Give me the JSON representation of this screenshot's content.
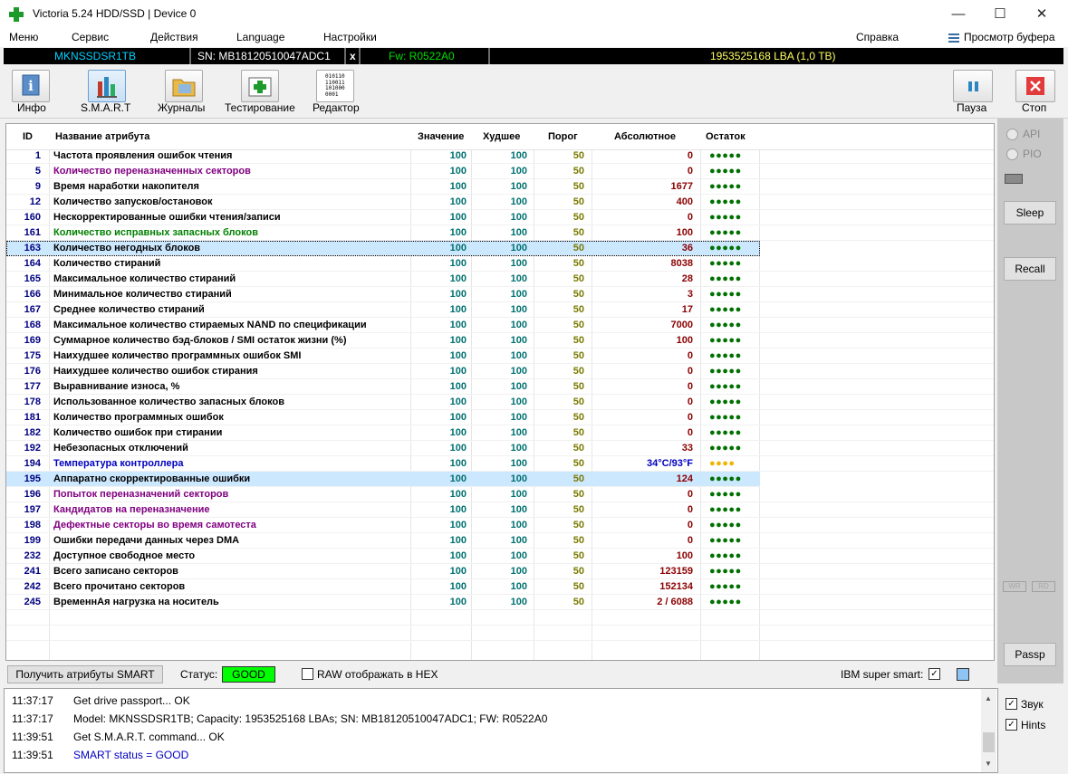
{
  "window": {
    "title": "Victoria 5.24 HDD/SSD | Device 0",
    "minimize": "—",
    "maximize": "☐",
    "close": "✕"
  },
  "menu": {
    "items": [
      "Меню",
      "Сервис",
      "Действия",
      "Language",
      "Настройки"
    ],
    "help": "Справка",
    "buffer": "Просмотр буфера"
  },
  "device": {
    "model": "MKNSSDSR1TB",
    "serial": "SN: MB18120510047ADC1",
    "close": "x",
    "firmware": "Fw: R0522A0",
    "capacity": "1953525168 LBA (1,0 TB)"
  },
  "toolbar": {
    "info": "Инфо",
    "smart": "S.M.A.R.T",
    "logs": "Журналы",
    "testing": "Тестирование",
    "editor": "Редактор",
    "editor_icon_text": "010110\n110011\n101000\n0001",
    "pause": "Пауза",
    "stop": "Стоп"
  },
  "table": {
    "headers": [
      "ID",
      "Название атрибута",
      "Значение",
      "Худшее",
      "Порог",
      "Абсолютное",
      "Остаток"
    ],
    "rows": [
      {
        "id": "1",
        "name": "Частота проявления ошибок чтения",
        "value": "100",
        "worst": "100",
        "threshold": "50",
        "raw": "0",
        "rem": "●●●●●",
        "color": "#000000"
      },
      {
        "id": "5",
        "name": "Количество переназначенных секторов",
        "value": "100",
        "worst": "100",
        "threshold": "50",
        "raw": "0",
        "rem": "●●●●●",
        "color": "#800080"
      },
      {
        "id": "9",
        "name": "Время наработки накопителя",
        "value": "100",
        "worst": "100",
        "threshold": "50",
        "raw": "1677",
        "rem": "●●●●●",
        "color": "#000000"
      },
      {
        "id": "12",
        "name": "Количество запусков/остановок",
        "value": "100",
        "worst": "100",
        "threshold": "50",
        "raw": "400",
        "rem": "●●●●●",
        "color": "#000000"
      },
      {
        "id": "160",
        "name": "Нескорректированные ошибки чтения/записи",
        "value": "100",
        "worst": "100",
        "threshold": "50",
        "raw": "0",
        "rem": "●●●●●",
        "color": "#000000"
      },
      {
        "id": "161",
        "name": "Количество исправных запасных блоков",
        "value": "100",
        "worst": "100",
        "threshold": "50",
        "raw": "100",
        "rem": "●●●●●",
        "color": "#008000"
      },
      {
        "id": "163",
        "name": "Количество негодных блоков",
        "value": "100",
        "worst": "100",
        "threshold": "50",
        "raw": "36",
        "rem": "●●●●●",
        "color": "#000000",
        "selected": true
      },
      {
        "id": "164",
        "name": "Количество стираний",
        "value": "100",
        "worst": "100",
        "threshold": "50",
        "raw": "8038",
        "rem": "●●●●●",
        "color": "#000000"
      },
      {
        "id": "165",
        "name": "Максимальное количество стираний",
        "value": "100",
        "worst": "100",
        "threshold": "50",
        "raw": "28",
        "rem": "●●●●●",
        "color": "#000000"
      },
      {
        "id": "166",
        "name": "Минимальное количество стираний",
        "value": "100",
        "worst": "100",
        "threshold": "50",
        "raw": "3",
        "rem": "●●●●●",
        "color": "#000000"
      },
      {
        "id": "167",
        "name": "Среднее количество стираний",
        "value": "100",
        "worst": "100",
        "threshold": "50",
        "raw": "17",
        "rem": "●●●●●",
        "color": "#000000"
      },
      {
        "id": "168",
        "name": "Максимальное количество стираемых NAND по спецификации",
        "value": "100",
        "worst": "100",
        "threshold": "50",
        "raw": "7000",
        "rem": "●●●●●",
        "color": "#000000"
      },
      {
        "id": "169",
        "name": "Суммарное количество бэд-блоков / SMI остаток жизни (%)",
        "value": "100",
        "worst": "100",
        "threshold": "50",
        "raw": "100",
        "rem": "●●●●●",
        "color": "#000000"
      },
      {
        "id": "175",
        "name": "Наихудшее количество программных ошибок SMI",
        "value": "100",
        "worst": "100",
        "threshold": "50",
        "raw": "0",
        "rem": "●●●●●",
        "color": "#000000"
      },
      {
        "id": "176",
        "name": "Наихудшее количество ошибок стирания",
        "value": "100",
        "worst": "100",
        "threshold": "50",
        "raw": "0",
        "rem": "●●●●●",
        "color": "#000000"
      },
      {
        "id": "177",
        "name": "Выравнивание износа, %",
        "value": "100",
        "worst": "100",
        "threshold": "50",
        "raw": "0",
        "rem": "●●●●●",
        "color": "#000000"
      },
      {
        "id": "178",
        "name": "Использованное количество запасных блоков",
        "value": "100",
        "worst": "100",
        "threshold": "50",
        "raw": "0",
        "rem": "●●●●●",
        "color": "#000000"
      },
      {
        "id": "181",
        "name": "Количество программных ошибок",
        "value": "100",
        "worst": "100",
        "threshold": "50",
        "raw": "0",
        "rem": "●●●●●",
        "color": "#000000"
      },
      {
        "id": "182",
        "name": "Количество ошибок при стирании",
        "value": "100",
        "worst": "100",
        "threshold": "50",
        "raw": "0",
        "rem": "●●●●●",
        "color": "#000000"
      },
      {
        "id": "192",
        "name": "Небезопасных отключений",
        "value": "100",
        "worst": "100",
        "threshold": "50",
        "raw": "33",
        "rem": "●●●●●",
        "color": "#000000"
      },
      {
        "id": "194",
        "name": "Температура контроллера",
        "value": "100",
        "worst": "100",
        "threshold": "50",
        "raw": "34°C/93°F",
        "rem": "●●●●",
        "color": "#0000c0",
        "rawcolor": "#0000c0",
        "remcolor": "#f0b400"
      },
      {
        "id": "195",
        "name": "Аппаратно скорректированные ошибки",
        "value": "100",
        "worst": "100",
        "threshold": "50",
        "raw": "124",
        "rem": "●●●●●",
        "color": "#000000",
        "highlight": true
      },
      {
        "id": "196",
        "name": "Попыток переназначений секторов",
        "value": "100",
        "worst": "100",
        "threshold": "50",
        "raw": "0",
        "rem": "●●●●●",
        "color": "#800080"
      },
      {
        "id": "197",
        "name": "Кандидатов на переназначение",
        "value": "100",
        "worst": "100",
        "threshold": "50",
        "raw": "0",
        "rem": "●●●●●",
        "color": "#800080"
      },
      {
        "id": "198",
        "name": "Дефектные секторы во время самотеста",
        "value": "100",
        "worst": "100",
        "threshold": "50",
        "raw": "0",
        "rem": "●●●●●",
        "color": "#800080"
      },
      {
        "id": "199",
        "name": "Ошибки передачи данных через DMA",
        "value": "100",
        "worst": "100",
        "threshold": "50",
        "raw": "0",
        "rem": "●●●●●",
        "color": "#000000"
      },
      {
        "id": "232",
        "name": "Доступное свободное место",
        "value": "100",
        "worst": "100",
        "threshold": "50",
        "raw": "100",
        "rem": "●●●●●",
        "color": "#000000"
      },
      {
        "id": "241",
        "name": "Всего записано секторов",
        "value": "100",
        "worst": "100",
        "threshold": "50",
        "raw": "123159",
        "rem": "●●●●●",
        "color": "#000000"
      },
      {
        "id": "242",
        "name": "Всего прочитано секторов",
        "value": "100",
        "worst": "100",
        "threshold": "50",
        "raw": "152134",
        "rem": "●●●●●",
        "color": "#000000"
      },
      {
        "id": "245",
        "name": "ВременнАя нагрузка на носитель",
        "value": "100",
        "worst": "100",
        "threshold": "50",
        "raw": "2 / 6088",
        "rem": "●●●●●",
        "color": "#000000"
      }
    ]
  },
  "status": {
    "get_smart_button": "Получить атрибуты SMART",
    "status_label": "Статус:",
    "status_value": "GOOD",
    "raw_hex_label": "RAW отображать в HEX",
    "ibm_label": "IBM super smart:"
  },
  "side": {
    "api": "API",
    "pio": "PIO",
    "sleep": "Sleep",
    "recall": "Recall",
    "wr": "WR",
    "rd": "RD",
    "passp": "Passp",
    "sound": "Звук",
    "hints": "Hints"
  },
  "log": [
    {
      "time": "11:37:17",
      "text": "Get drive passport... OK",
      "color": "#000000"
    },
    {
      "time": "11:37:17",
      "text": "Model: MKNSSDSR1TB; Capacity: 1953525168 LBAs; SN: MB18120510047ADC1; FW: R0522A0",
      "color": "#000000"
    },
    {
      "time": "11:39:51",
      "text": "Get S.M.A.R.T. command... OK",
      "color": "#000000"
    },
    {
      "time": "11:39:51",
      "text": "SMART status = GOOD",
      "color": "#0000c0"
    }
  ]
}
